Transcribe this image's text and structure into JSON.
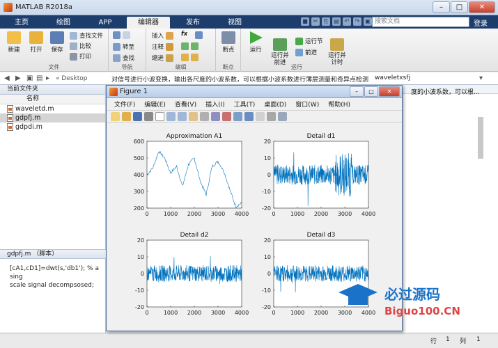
{
  "window": {
    "title": "MATLAB R2018a"
  },
  "tabs": [
    {
      "label": "主页"
    },
    {
      "label": "绘图"
    },
    {
      "label": "APP"
    },
    {
      "label": "编辑器"
    },
    {
      "label": "发布"
    },
    {
      "label": "视图"
    }
  ],
  "search": {
    "placeholder": "搜索文档"
  },
  "login": "登录",
  "ribbon": {
    "file": {
      "new": "新建",
      "open": "打开",
      "save": "保存",
      "find_files": "查找文件",
      "compare": "比较",
      "print": "打印",
      "group": "文件"
    },
    "nav": {
      "goto": "转至",
      "find": "查找",
      "group": "导航"
    },
    "edit": {
      "insert": "插入",
      "comment": "注释",
      "indent": "缩进",
      "fx": "fx",
      "group": "编辑"
    },
    "breakpoints": {
      "label": "断点",
      "group": "断点"
    },
    "run": {
      "run": "运行",
      "run_advance": "运行并\n前进",
      "run_section": "运行节",
      "advance": "前进",
      "run_time": "运行并\n计时",
      "group": "运行"
    }
  },
  "path": {
    "prefix": "« Desktop",
    "folder": "对信号进行小波变换，输出各尺度的小波系数，可以根据小波系数进行薄层测量和奇异点检测",
    "sub": "waveletxsfj"
  },
  "left": {
    "title": "当前文件夹",
    "col": "名称",
    "files": [
      "waveletd.m",
      "gdpfj.m",
      "gdpdi.m"
    ],
    "details_title": "gdpfj.m （脚本）",
    "code": [
      "[cA1,cD1]=dwt(s,'db1'); % a sing",
      "scale signal decompsosed;"
    ]
  },
  "right_text": "度的小波系数，可以根...",
  "status": {
    "row_label": "行",
    "row": "1",
    "col_label": "列",
    "col": "1"
  },
  "figure": {
    "title": "Figure 1",
    "menu": [
      "文件(F)",
      "编辑(E)",
      "查看(V)",
      "插入(I)",
      "工具(T)",
      "桌面(D)",
      "窗口(W)",
      "帮助(H)"
    ],
    "line_color": "#0072BD"
  },
  "chart_data": [
    {
      "type": "line",
      "title": "Approximation A1",
      "xlim": [
        0,
        4000
      ],
      "ylim": [
        200,
        600
      ],
      "yticks": [
        200,
        300,
        400,
        500,
        600
      ],
      "xticks": [
        0,
        1000,
        2000,
        3000,
        4000
      ],
      "x": [
        0,
        250,
        500,
        750,
        1000,
        1250,
        1500,
        1750,
        2000,
        2250,
        2500,
        2750,
        3000,
        3250,
        3500,
        3750,
        4000
      ],
      "y": [
        400,
        440,
        540,
        500,
        410,
        450,
        330,
        460,
        500,
        360,
        280,
        450,
        480,
        420,
        310,
        210,
        230
      ]
    },
    {
      "type": "line",
      "title": "Detail d1",
      "xlim": [
        0,
        4000
      ],
      "ylim": [
        -20,
        20
      ],
      "yticks": [
        -20,
        -10,
        0,
        10,
        20
      ],
      "xticks": [
        0,
        1000,
        2000,
        3000,
        4000
      ],
      "approx_noise_amplitude": 6
    },
    {
      "type": "line",
      "title": "Detail d2",
      "xlim": [
        0,
        4000
      ],
      "ylim": [
        -20,
        20
      ],
      "yticks": [
        -20,
        -10,
        0,
        10,
        20
      ],
      "xticks": [
        0,
        1000,
        2000,
        3000,
        4000
      ],
      "approx_noise_amplitude": 5
    },
    {
      "type": "line",
      "title": "Detail d3",
      "xlim": [
        0,
        4000
      ],
      "ylim": [
        -20,
        20
      ],
      "yticks": [
        -20,
        -10,
        0,
        10,
        20
      ],
      "xticks": [
        0,
        1000,
        2000,
        3000,
        4000
      ],
      "approx_noise_amplitude": 5
    }
  ],
  "watermark": {
    "line1": "必过源码",
    "line2": "Biguo100.CN"
  }
}
